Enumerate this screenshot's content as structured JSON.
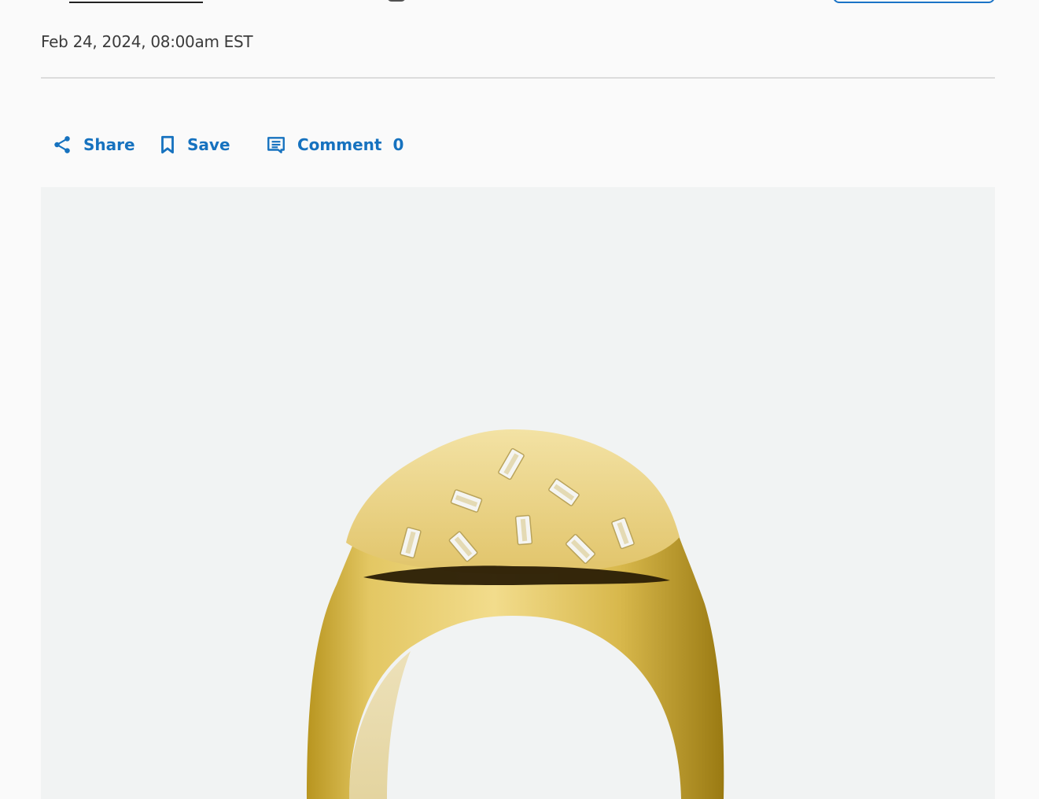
{
  "article": {
    "timestamp": "Feb 24, 2024, 08:00am EST"
  },
  "actions": {
    "share_label": "Share",
    "save_label": "Save",
    "comment_label": "Comment",
    "comment_count": "0"
  },
  "colors": {
    "accent": "#1672bf",
    "background": "#fafafa",
    "image_background": "#f1f3f3",
    "gold": "#d9b94a"
  },
  "icons": {
    "share": "share-icon",
    "save": "bookmark-icon",
    "comment": "comment-icon"
  }
}
